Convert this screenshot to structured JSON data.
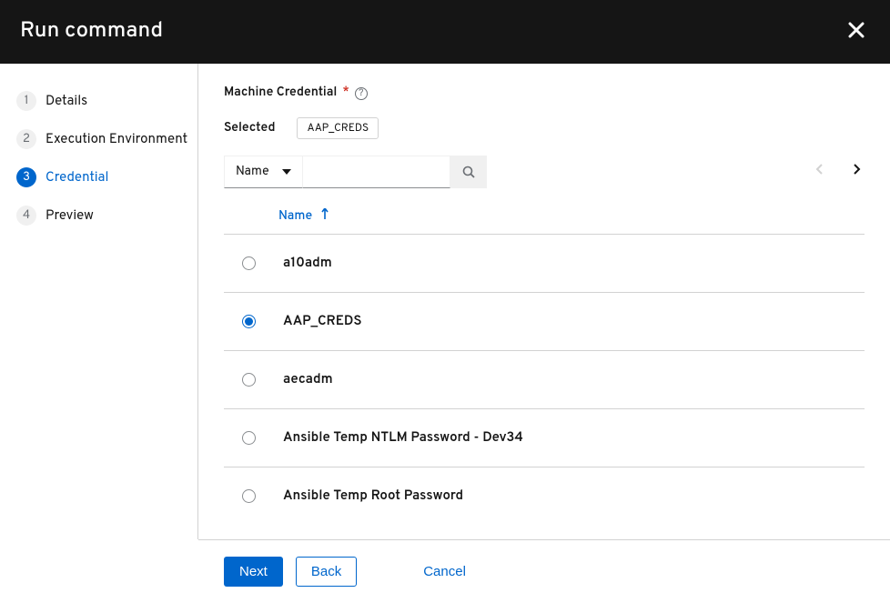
{
  "header": {
    "title": "Run command"
  },
  "wizard": {
    "steps": [
      {
        "num": "1",
        "label": "Details"
      },
      {
        "num": "2",
        "label": "Execution Environment"
      },
      {
        "num": "3",
        "label": "Credential"
      },
      {
        "num": "4",
        "label": "Preview"
      }
    ],
    "active_index": 2
  },
  "content": {
    "field_label": "Machine Credential",
    "selected_label": "Selected",
    "selected_chip": "AAP_CREDS",
    "filter_by": "Name",
    "column_header": "Name",
    "rows": [
      {
        "name": "a10adm",
        "checked": false
      },
      {
        "name": "AAP_CREDS",
        "checked": true
      },
      {
        "name": "aecadm",
        "checked": false
      },
      {
        "name": "Ansible Temp NTLM Password - Dev34",
        "checked": false
      },
      {
        "name": "Ansible Temp Root Password",
        "checked": false
      }
    ]
  },
  "footer": {
    "next": "Next",
    "back": "Back",
    "cancel": "Cancel"
  }
}
